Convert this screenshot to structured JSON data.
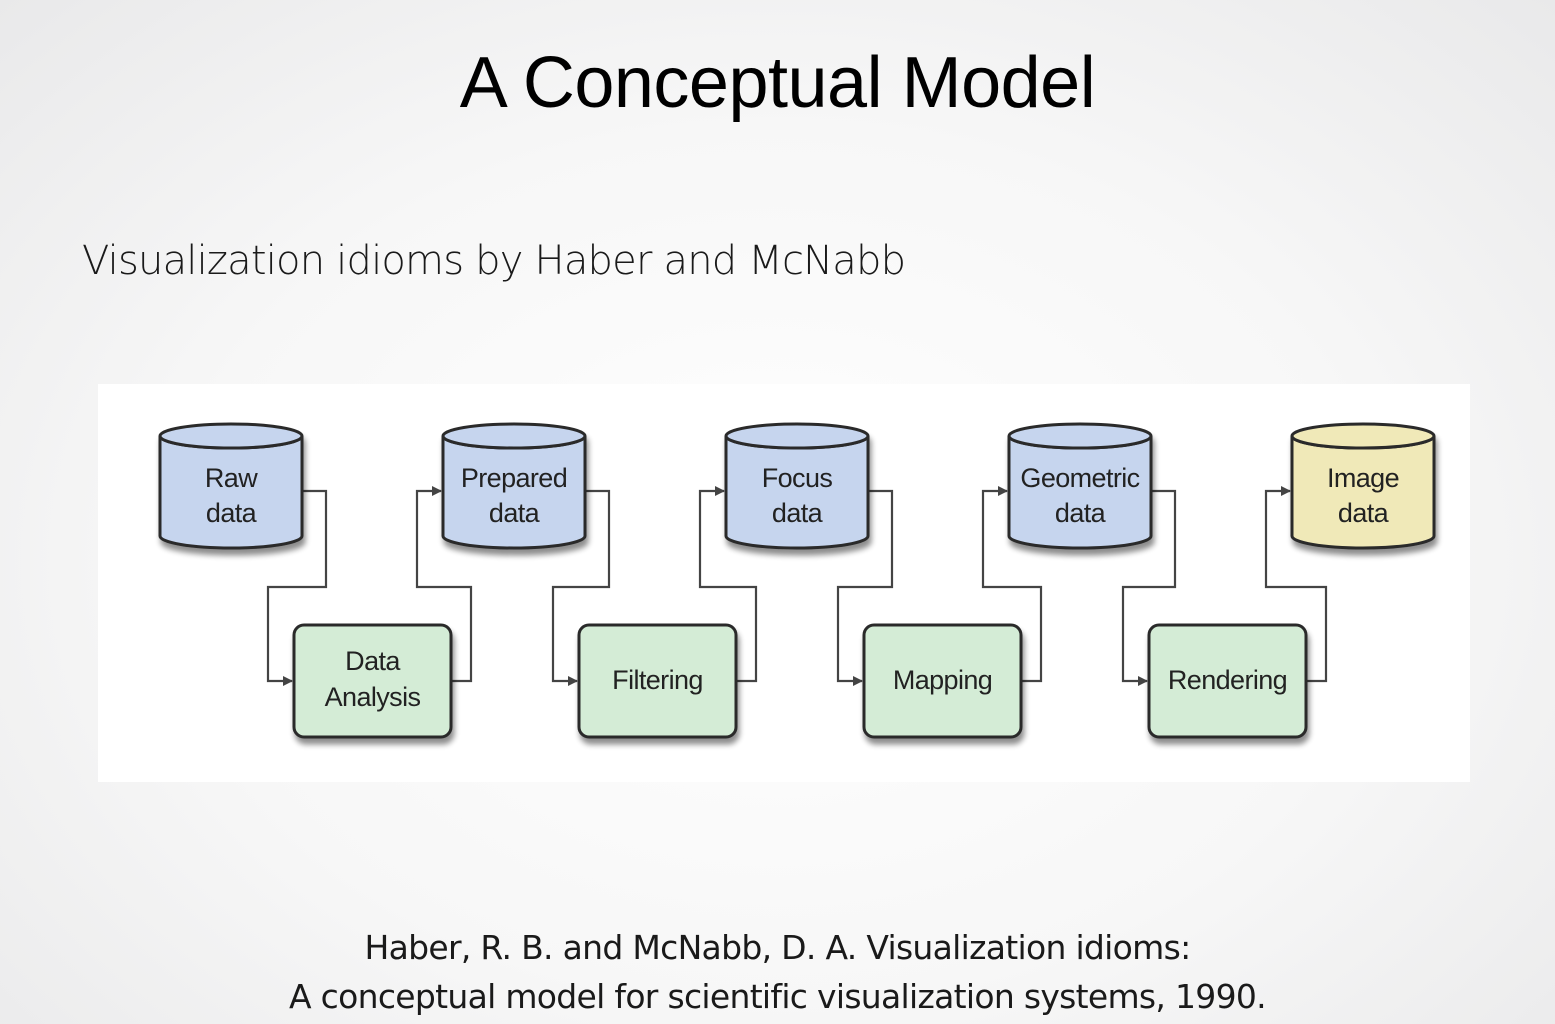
{
  "slide": {
    "title": "A Conceptual Model",
    "subtitle": "Visualization idioms by Haber and McNabb",
    "citation_line1": "Haber, R. B. and McNabb, D. A. Visualization idioms:",
    "citation_line2": "A conceptual model for scientific visualization systems, 1990."
  },
  "diagram": {
    "data_stores": [
      {
        "line1": "Raw",
        "line2": "data",
        "color": "#c6d5ee"
      },
      {
        "line1": "Prepared",
        "line2": "data",
        "color": "#c6d5ee"
      },
      {
        "line1": "Focus",
        "line2": "data",
        "color": "#c6d5ee"
      },
      {
        "line1": "Geometric",
        "line2": "data",
        "color": "#c6d5ee"
      },
      {
        "line1": "Image",
        "line2": "data",
        "color": "#f0e9b8"
      }
    ],
    "processes": [
      {
        "line1": "Data",
        "line2": "Analysis",
        "color": "#d4ecd6"
      },
      {
        "line1": "Filtering",
        "line2": "",
        "color": "#d4ecd6"
      },
      {
        "line1": "Mapping",
        "line2": "",
        "color": "#d4ecd6"
      },
      {
        "line1": "Rendering",
        "line2": "",
        "color": "#d4ecd6"
      }
    ],
    "edge_color": "#444444"
  }
}
